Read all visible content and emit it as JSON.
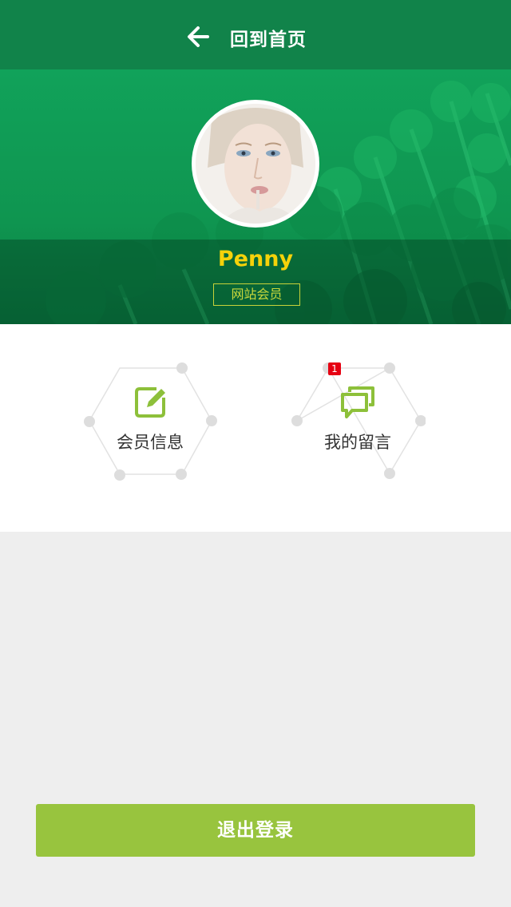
{
  "header": {
    "back_label": "回到首页",
    "back_icon": "arrow-left-icon",
    "bg_color": "#11834a"
  },
  "profile": {
    "name": "Penny",
    "badge": "网站会员",
    "name_color": "#f5d20a",
    "badge_color": "#c9d83c"
  },
  "actions": [
    {
      "label": "会员信息",
      "icon": "edit-icon",
      "notifications": ""
    },
    {
      "label": "我的留言",
      "icon": "chat-bubbles-icon",
      "notifications": "1"
    }
  ],
  "logout": {
    "label": "退出登录",
    "color": "#98c43e"
  }
}
